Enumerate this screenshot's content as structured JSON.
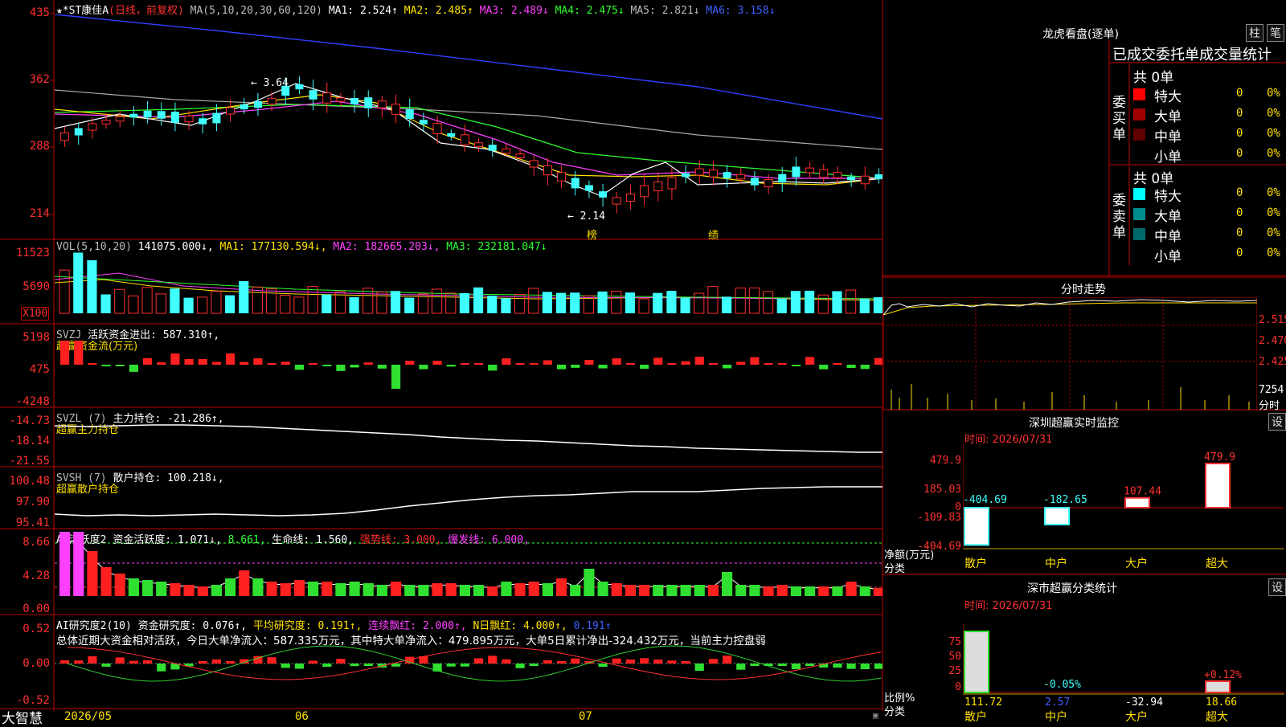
{
  "main": {
    "title_stock": "★*ST康佳A",
    "title_mode": "(日线，前复权)",
    "ma_label": "MA(5,10,20,30,60,120)",
    "ma_values": [
      {
        "name": "MA1:",
        "value": "2.524↑",
        "color": "#ffffff"
      },
      {
        "name": "MA2:",
        "value": "2.485↑",
        "color": "#ffe000"
      },
      {
        "name": "MA3:",
        "value": "2.489↓",
        "color": "#ff40ff"
      },
      {
        "name": "MA4:",
        "value": "2.475↓",
        "color": "#30ff30"
      },
      {
        "name": "MA5:",
        "value": "2.821↓",
        "color": "#bbbbbb"
      },
      {
        "name": "MA6:",
        "value": "3.158↓",
        "color": "#4060ff"
      }
    ],
    "y_labels": [
      "435",
      "362",
      "288",
      "214"
    ],
    "high_label": "3.64",
    "low_label": "2.14",
    "event_labels": [
      "榜",
      "绩"
    ],
    "price_scale": [
      2.14,
      4.35
    ]
  },
  "volume": {
    "label": "VOL(5,10,20)",
    "value": "141075.000↓,",
    "ma1": "MA1: 177130.594↓,",
    "ma2": "MA2: 182665.203↓,",
    "ma3": "MA3: 232181.047↓",
    "y_labels": [
      "11523",
      "5690",
      "X100"
    ]
  },
  "svzj": {
    "label": "SVZJ",
    "text": "活跃资金进出: 587.310↑,",
    "sub": "超赢资金流(万元)",
    "y_labels": [
      "5198",
      "475",
      "-4248"
    ]
  },
  "svzl": {
    "label": "SVZL (7)",
    "text": "主力持仓: -21.286↑,",
    "sub": "超赢主力持仓",
    "y_labels": [
      "-14.73",
      "-18.14",
      "-21.55"
    ]
  },
  "svsh": {
    "label": "SVSH (7)",
    "text": "散户持仓: 100.218↓,",
    "sub": "超赢散户持仓",
    "y_labels": [
      "100.48",
      "97.90",
      "95.41"
    ]
  },
  "ai_active": {
    "label": "AI活跃度2",
    "t1": "资金活跃度: 1.071↓,",
    "t2": "8.661,",
    "t3": "生命线: 1.560,",
    "t4": "强势线: 3.000,",
    "t5": "爆发线: 6.000,",
    "y_labels": [
      "8.66",
      "4.28",
      "0.00"
    ]
  },
  "ai_research": {
    "label": "AI研究度2(10)",
    "t1": "资金研究度: 0.076↑,",
    "t2": "平均研究度: 0.191↑,",
    "t3": "连续飘红: 2.000↑,",
    "t4": "N日飘红: 4.000↑,",
    "t5": "0.191↑",
    "summary": "总体近期大资金相对活跃，今日大单净流入：587.335万元，其中特大单净流入：479.895万元，大单5日累计净出-324.432万元，当前主力控盘弱",
    "y_labels": [
      "0.52",
      "0.00",
      "-0.52"
    ]
  },
  "bottom": {
    "brand": "大智慧",
    "dates": [
      "2026/05",
      "06",
      "07"
    ]
  },
  "right": {
    "title": "龙虎看盘(逐单)",
    "btn_pillar": "柱",
    "btn_pen": "笔",
    "stats_title": "已成交委托单成交量统计",
    "buy_side": "委买单",
    "sell_side": "委卖单",
    "buy_total": "共 0单",
    "sell_total": "共 0单",
    "buy_rows": [
      {
        "label": "特大",
        "count": "0",
        "pct": "0%",
        "color": "#ff0000"
      },
      {
        "label": "大单",
        "count": "0",
        "pct": "0%",
        "color": "#a00000"
      },
      {
        "label": "中单",
        "count": "0",
        "pct": "0%",
        "color": "#600000"
      },
      {
        "label": "小单",
        "count": "0",
        "pct": "0%",
        "color": "#000000"
      }
    ],
    "sell_rows": [
      {
        "label": "特大",
        "count": "0",
        "pct": "0%",
        "color": "#00ffff"
      },
      {
        "label": "大单",
        "count": "0",
        "pct": "0%",
        "color": "#008c8c"
      },
      {
        "label": "中单",
        "count": "0",
        "pct": "0%",
        "color": "#006a6a"
      },
      {
        "label": "小单",
        "count": "0",
        "pct": "0%",
        "color": "#000000"
      }
    ],
    "intraday_title": "分时走势",
    "intraday_y": [
      "2.515",
      "2.470",
      "2.425"
    ],
    "intraday_vol": "7254",
    "intraday_unit": "分时",
    "monitor_title": "深圳超赢实时监控",
    "monitor_settings": "设",
    "monitor_time": "时间: 2026/07/31",
    "monitor_y": [
      "479.9",
      "185.03",
      "0",
      "-109.83",
      "-404.69"
    ],
    "monitor_ylabel1": "净额(万元)",
    "monitor_ylabel2": "分类",
    "monitor_cats": [
      "散户",
      "中户",
      "大户",
      "超大"
    ],
    "monitor_values": [
      -404.69,
      -182.65,
      107.44,
      479.9
    ],
    "monitor_value_labels": [
      "-404.69",
      "-182.65",
      "107.44",
      "479.9"
    ],
    "class_title": "深市超赢分类统计",
    "class_settings": "设",
    "class_time": "时间: 2026/07/31",
    "class_y": [
      "75",
      "50",
      "25",
      "0"
    ],
    "class_ylabel1": "比例%",
    "class_ylabel2": "分类",
    "class_cats": [
      "散户",
      "中户",
      "大户",
      "超大"
    ],
    "class_values": [
      "111.72",
      "2.57",
      "-32.94",
      "18.66"
    ],
    "class_pct_labels": [
      "-0.05%",
      "+0.12%"
    ]
  },
  "chart_data": [
    {
      "type": "line",
      "title": "★*ST康佳A",
      "x": [
        "2026/05",
        "06",
        "07"
      ],
      "ylim": [
        2.14,
        4.35
      ],
      "series": [
        {
          "name": "MA1",
          "last": 2.524
        },
        {
          "name": "MA2",
          "last": 2.485
        },
        {
          "name": "MA3",
          "last": 2.489
        },
        {
          "name": "MA4",
          "last": 2.475
        },
        {
          "name": "MA5",
          "last": 2.821
        },
        {
          "name": "MA6",
          "last": 3.158
        }
      ],
      "annotations": [
        "3.64",
        "2.14"
      ]
    },
    {
      "type": "bar",
      "title": "深圳超赢实时监控",
      "categories": [
        "散户",
        "中户",
        "大户",
        "超大"
      ],
      "values": [
        -404.69,
        -182.65,
        107.44,
        479.9
      ],
      "ylim": [
        -404.69,
        479.9
      ]
    },
    {
      "type": "bar",
      "title": "深市超赢分类统计",
      "categories": [
        "散户",
        "中户",
        "大户",
        "超大"
      ],
      "values": [
        111.72,
        2.57,
        -32.94,
        18.66
      ],
      "ylim": [
        0,
        75
      ]
    }
  ]
}
